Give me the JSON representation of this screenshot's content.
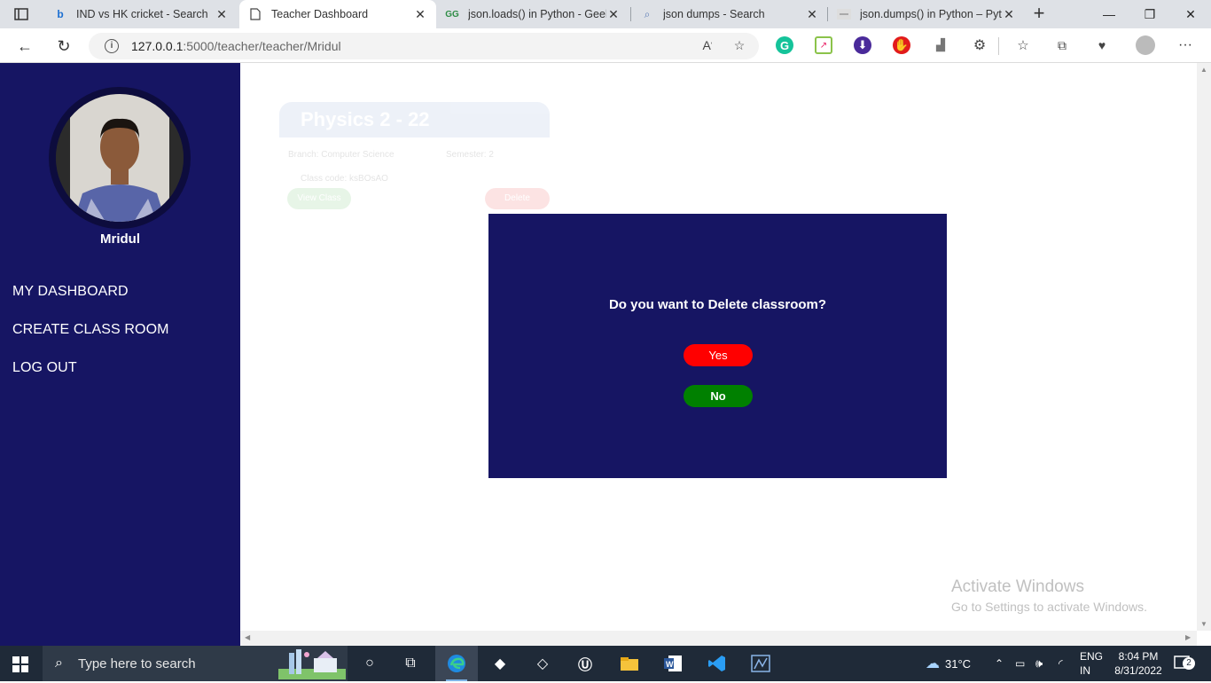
{
  "browser": {
    "tabs": [
      {
        "title": "IND vs HK cricket - Search",
        "favicon": "bing-icon"
      },
      {
        "title": "Teacher Dashboard",
        "favicon": "page-icon"
      },
      {
        "title": "json.loads() in Python - Geek",
        "favicon": "geeks-icon"
      },
      {
        "title": "json dumps - Search",
        "favicon": "search-icon"
      },
      {
        "title": "json.dumps() in Python – Pyth",
        "favicon": "pyth-icon"
      }
    ],
    "url_host": "127.0.0.1",
    "url_path": ":5000/teacher/teacher/Mridul"
  },
  "sidebar": {
    "username": "Mridul",
    "nav": [
      {
        "label": "MY DASHBOARD"
      },
      {
        "label": "CREATE CLASS ROOM"
      },
      {
        "label": "LOG OUT"
      }
    ]
  },
  "card": {
    "title": "Physics 2 - 22",
    "branch": "Branch: Computer Science",
    "semester": "Semester: 2",
    "class_code": "Class code: ksBOsAO",
    "view_label": "View Class",
    "delete_label": "Delete"
  },
  "modal": {
    "question": "Do you want to Delete classroom?",
    "yes_label": "Yes",
    "no_label": "No"
  },
  "watermark": {
    "line1": "Activate Windows",
    "line2": "Go to Settings to activate Windows."
  },
  "taskbar": {
    "search_placeholder": "Type here to search",
    "weather": "31°C",
    "lang_top": "ENG",
    "lang_bottom": "IN",
    "time": "8:04 PM",
    "date": "8/31/2022",
    "notifications": "2"
  },
  "colors": {
    "sidebar": "#161563",
    "modal": "#161563",
    "yes": "#ff0000",
    "no": "#008000"
  }
}
